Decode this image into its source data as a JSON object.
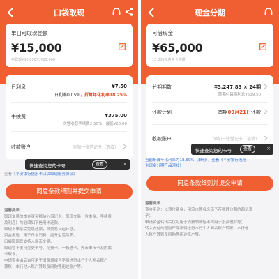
{
  "theme": {
    "brand": "#ef5f31",
    "link": "#3a78d6",
    "toast_bg": "#2e2e2e"
  },
  "left": {
    "title": "口袋取现",
    "amount_label": "单日可取现金额",
    "amount": "¥15,000",
    "amount_note": "可取现¥00,000元/¥15,000",
    "rate_label": "日利息",
    "rate_value": "¥7.50",
    "rate_sub_prefix": "日利率0.05%，",
    "rate_sub_accent": "折算年化利率18.25%",
    "fee_label": "手续费",
    "fee_value": "¥375.00",
    "fee_sub": "一次性收取手续费2.50%，最低¥25.00",
    "account_label": "收款账户",
    "account_placeholder": "添加一张借记卡（选填）",
    "toast_text": "快速查询您的卡号",
    "toast_button": "查看",
    "toast_close": "×",
    "link_prefix": "查看",
    "link_text": "《平安银行信用卡口袋取现服务协议》",
    "cta": "同意条款细则并提交申请",
    "tips_title": "温馨提示：",
    "tips_lines": [
      "取现交易的本金资金额纳入借记卡，取现交易（含本金、手续费",
      "及利息）均必须如下信用卡还款。",
      "取现下单享受免息还款，自交易日起计息。",
      "资金用途：用于日常消费，提升生活品质。",
      "口袋取现仅支持人民币交易。",
      "取现暂不支持变更卡号、花费卡、一帐通卡、外币单币卡及附属",
      "卡取现。",
      "申请资金由后台可用于消费领域且不得进行本行个人网名账户",
      "转账，本行他人账户转账及网购等用途账户等。"
    ]
  },
  "right": {
    "title": "现金分期",
    "amount_label": "可借现金",
    "amount": "¥65,000",
    "amount_note": "15,000元信用卡余额",
    "term_label": "分期期数",
    "term_value": "¥3,247.83 × 24期",
    "term_sub": "首期付每期利息¥539.50",
    "plan_label": "还款计划",
    "plan_value_prefix": "首期",
    "plan_value_accent": "09月21日",
    "plan_value_suffix": "还款",
    "account_label": "收款账户",
    "account_placeholder": "添加一张借记卡（选填）",
    "toast_text": "快速查询您的卡号",
    "toast_button": "查看",
    "toast_close": "×",
    "rate_note_line1": "当前折算年化利率为18.69%（单利），查看《平安银行信用",
    "rate_note_line2": "卡现金分期产品须知》",
    "cta": "同意条款细则并提交申请",
    "tips_title": "温馨提示：",
    "tips_lines": [
      "资金用途：以转位资金，用流水等名义借予存数理分期的都是须",
      "子；",
      "申请资金转出后仅可用于消费领域但不得用于投资理财等；",
      "转入支付的理财产品不得进行本行个人网名账户转账，本行他",
      "人账户转账及网购等用途账户等。"
    ]
  }
}
